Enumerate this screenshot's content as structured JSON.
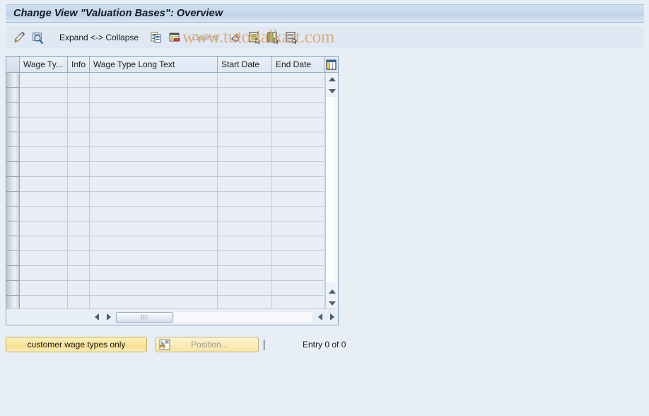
{
  "window": {
    "title": "Change View \"Valuation Bases\": Overview"
  },
  "watermark": {
    "text": "www.tutorialkart.com",
    "color": "#e0a96d"
  },
  "toolbar": {
    "items": [
      {
        "name": "change-display-icon",
        "label": "",
        "icon": "pencil-icon",
        "type": "icon",
        "enabled": true
      },
      {
        "name": "display-magnifier-icon",
        "label": "",
        "icon": "magnifier-icon",
        "type": "icon",
        "enabled": true
      },
      {
        "name": "expand-collapse-button",
        "label": "Expand <-> Collapse",
        "type": "text",
        "enabled": true
      },
      {
        "name": "copy-as-icon",
        "label": "",
        "icon": "copy-icon",
        "type": "icon",
        "enabled": true
      },
      {
        "name": "delete-row-icon",
        "label": "",
        "icon": "delete-row-icon",
        "type": "icon",
        "enabled": true
      },
      {
        "name": "delimit-button",
        "label": "Delimit",
        "type": "text",
        "enabled": false
      },
      {
        "name": "undo-icon",
        "label": "",
        "icon": "undo-icon",
        "type": "icon",
        "enabled": true
      },
      {
        "name": "select-all-icon",
        "label": "",
        "icon": "select-all-icon",
        "type": "icon",
        "enabled": true
      },
      {
        "name": "deselect-all-icon",
        "label": "",
        "icon": "deselect-all-icon",
        "type": "icon",
        "enabled": true
      },
      {
        "name": "select-block-icon",
        "label": "",
        "icon": "select-block-icon",
        "type": "icon",
        "enabled": true
      }
    ],
    "expand_collapse_label": "Expand <-> Collapse",
    "delimit_label": "Delimit"
  },
  "table": {
    "columns": [
      {
        "key": "row_selector",
        "label": ""
      },
      {
        "key": "wage_type",
        "label": "Wage Ty..."
      },
      {
        "key": "info",
        "label": "Info"
      },
      {
        "key": "long_text",
        "label": "Wage Type Long Text"
      },
      {
        "key": "start_date",
        "label": "Start Date"
      },
      {
        "key": "end_date",
        "label": "End Date"
      }
    ],
    "settings_icon": "table-settings-icon",
    "rows": [],
    "empty_row_count": 16
  },
  "scrollbars": {
    "vertical": {
      "up_arrow": "arrow-up-icon",
      "down_arrow": "arrow-down-icon"
    },
    "horizontal": {
      "left_arrow": "arrow-left-icon",
      "right_arrow": "arrow-right-icon"
    }
  },
  "footer": {
    "customer_wage_types_label": "customer wage types only",
    "position_label": "Position...",
    "position_icon": "position-goto-icon",
    "entry_count": "Entry 0 of 0"
  }
}
